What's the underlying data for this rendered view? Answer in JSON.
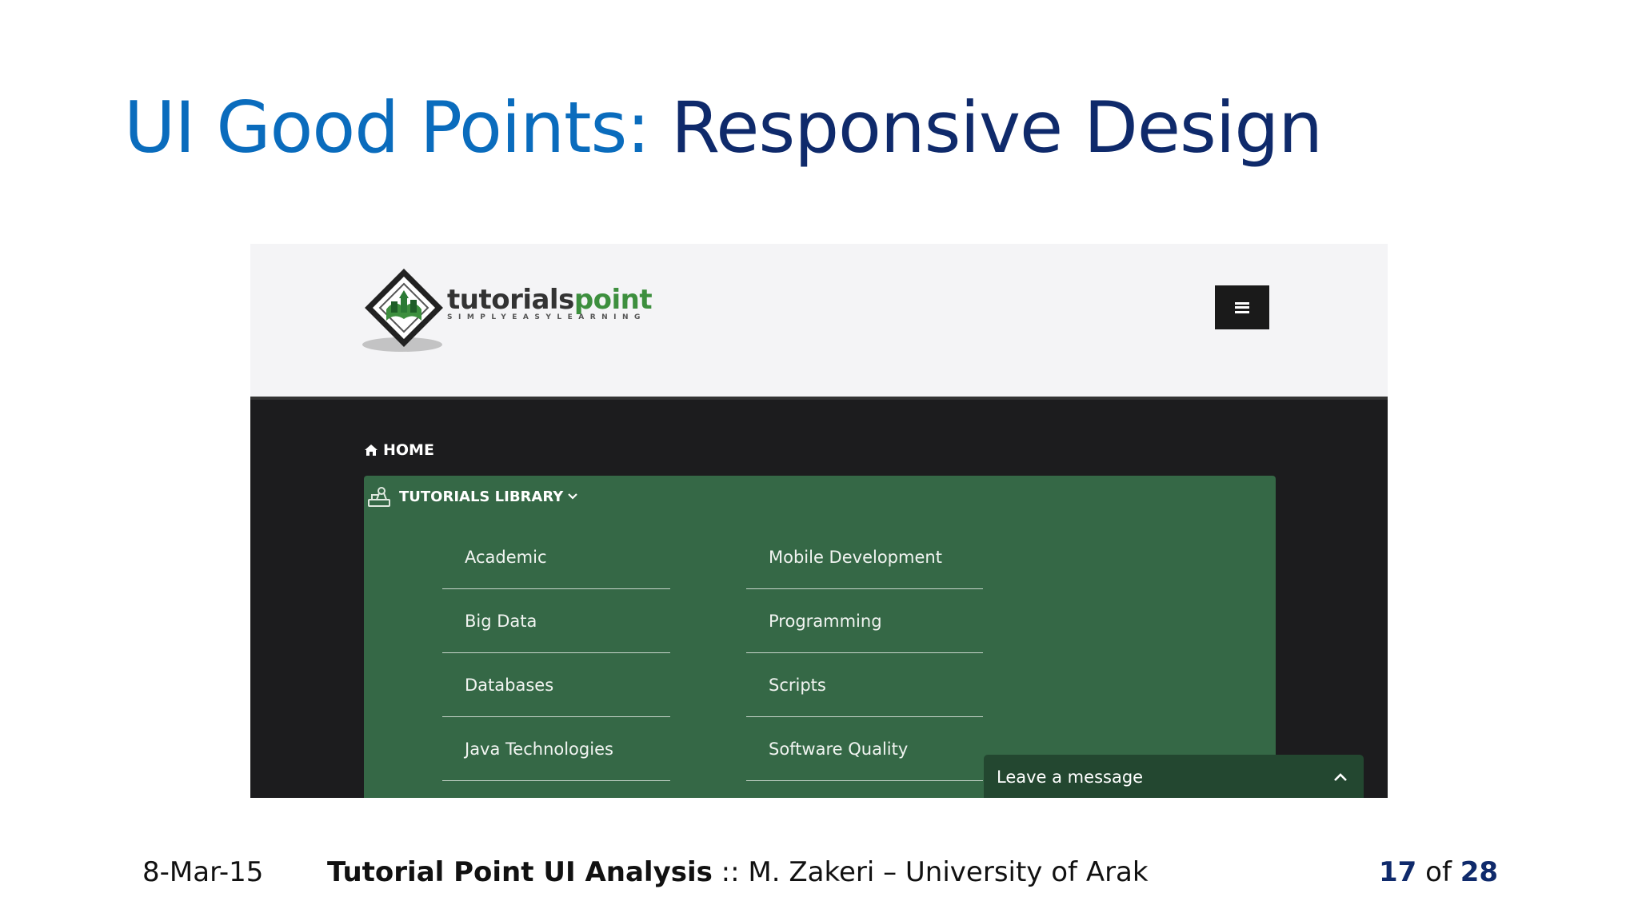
{
  "slide": {
    "title_accent": "UI Good Points:",
    "title_main": "Responsive Design",
    "colors": {
      "accent": "#0a6cbd",
      "dark_blue": "#0f2a6b"
    }
  },
  "screenshot": {
    "logo": {
      "word_dark": "tutorials",
      "word_green": "point",
      "tagline": "SIMPLYEASYLEARNING"
    },
    "menu_button_icon": "hamburger-icon",
    "nav": {
      "home_label": "HOME",
      "home_icon": "home-icon",
      "library_label": "TUTORIALS LIBRARY",
      "library_icon": "library-icon",
      "columns": [
        [
          "Academic",
          "Big Data",
          "Databases",
          "Java Technologies"
        ],
        [
          "Mobile Development",
          "Programming",
          "Scripts",
          "Software Quality"
        ]
      ]
    },
    "chat": {
      "label": "Leave a message",
      "icon": "chevron-up-icon"
    },
    "colors": {
      "header_bg": "#f4f4f6",
      "nav_bg": "#1c1c1e",
      "panel_green": "#356846",
      "chat_green": "#234730"
    }
  },
  "footer": {
    "date": "8-Mar-15",
    "title_bold": "Tutorial Point  UI Analysis",
    "separator": " :: ",
    "author": "M. Zakeri – University of Arak",
    "page_current": "17",
    "page_of": " of ",
    "page_total": "28"
  }
}
